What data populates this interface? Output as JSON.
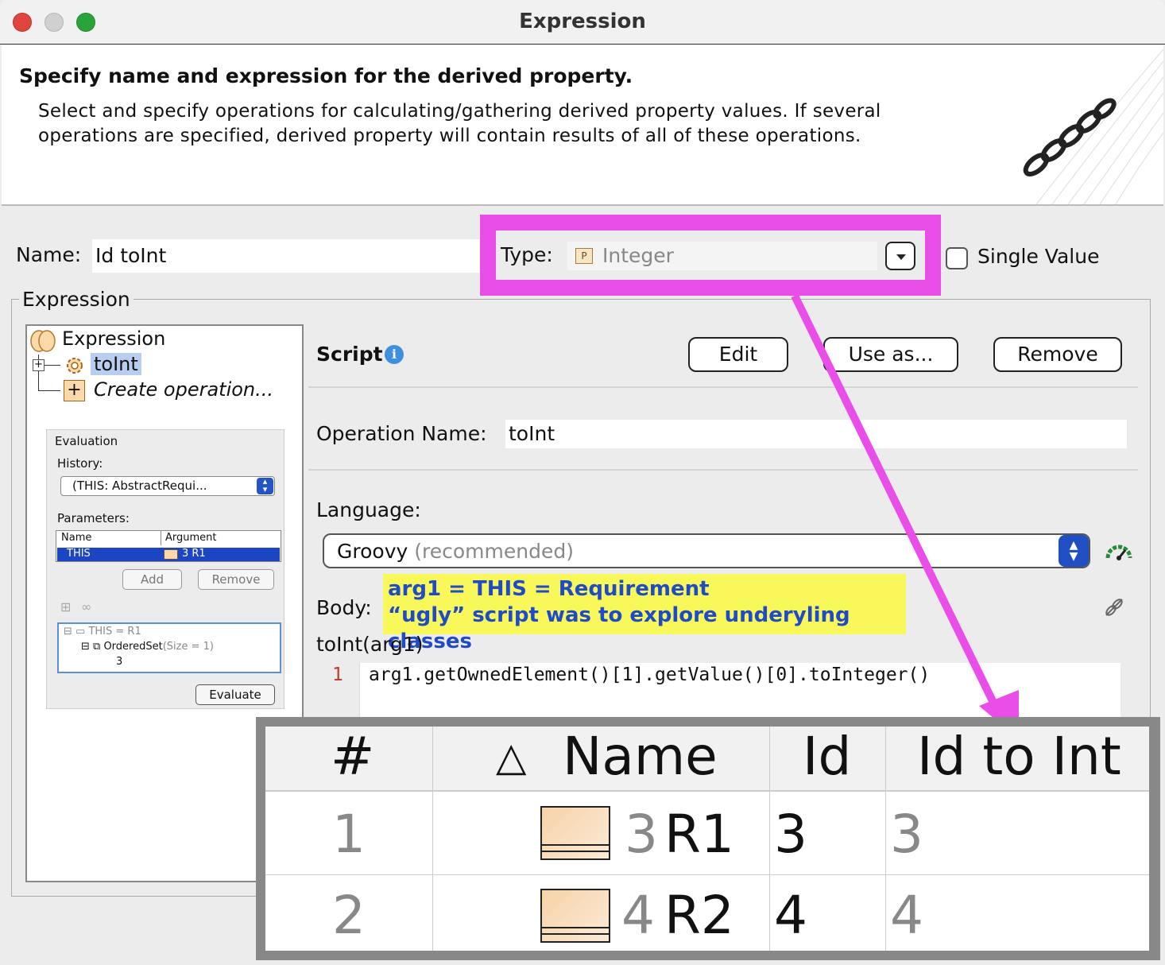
{
  "window": {
    "title": "Expression"
  },
  "header": {
    "title": "Specify name and expression for the derived property.",
    "description": "Select and specify operations for calculating/gathering derived property values. If several operations are specified, derived property will contain results of all of these operations."
  },
  "form": {
    "name_label": "Name:",
    "name_value": "Id toInt",
    "type_label": "Type:",
    "type_value": "Integer",
    "single_value_label": "Single Value",
    "expression_group": "Expression"
  },
  "tree": {
    "root": "Expression",
    "op": "toInt",
    "create": "Create operation..."
  },
  "evaluation": {
    "title": "Evaluation",
    "history_label": "History:",
    "history_value": "(THIS: AbstractRequi...",
    "parameters_label": "Parameters:",
    "col_name": "Name",
    "col_argument": "Argument",
    "row_name": "THIS",
    "row_arg": "3 R1",
    "add": "Add",
    "remove": "Remove",
    "result_root": "THIS = R1",
    "result_set": "OrderedSet",
    "result_size": "(Size = 1)",
    "result_val": "3",
    "evaluate": "Evaluate"
  },
  "script": {
    "title": "Script",
    "edit": "Edit",
    "use_as": "Use as...",
    "remove": "Remove",
    "op_name_label": "Operation Name:",
    "op_name_value": "toInt",
    "language_label": "Language:",
    "language_value": "Groovy",
    "language_note": "(recommended)",
    "body_label": "Body:",
    "signature": "toInt(arg1)",
    "line_no": "1",
    "code": "arg1.getOwnedElement()[1].getValue()[0].toInteger()"
  },
  "annotation": {
    "line1": "arg1 = THIS = Requirement",
    "line2": "“ugly” script was to explore underyling classes",
    "accent": "#e94ee9"
  },
  "result_table": {
    "headers": [
      "#",
      "Name",
      "Id",
      "Id to Int"
    ],
    "sort_glyph": "△",
    "rows": [
      {
        "num": "1",
        "name_id": "3",
        "name": "R1",
        "id": "3",
        "id_int": "3"
      },
      {
        "num": "2",
        "name_id": "4",
        "name": "R2",
        "id": "4",
        "id_int": "4"
      }
    ]
  }
}
